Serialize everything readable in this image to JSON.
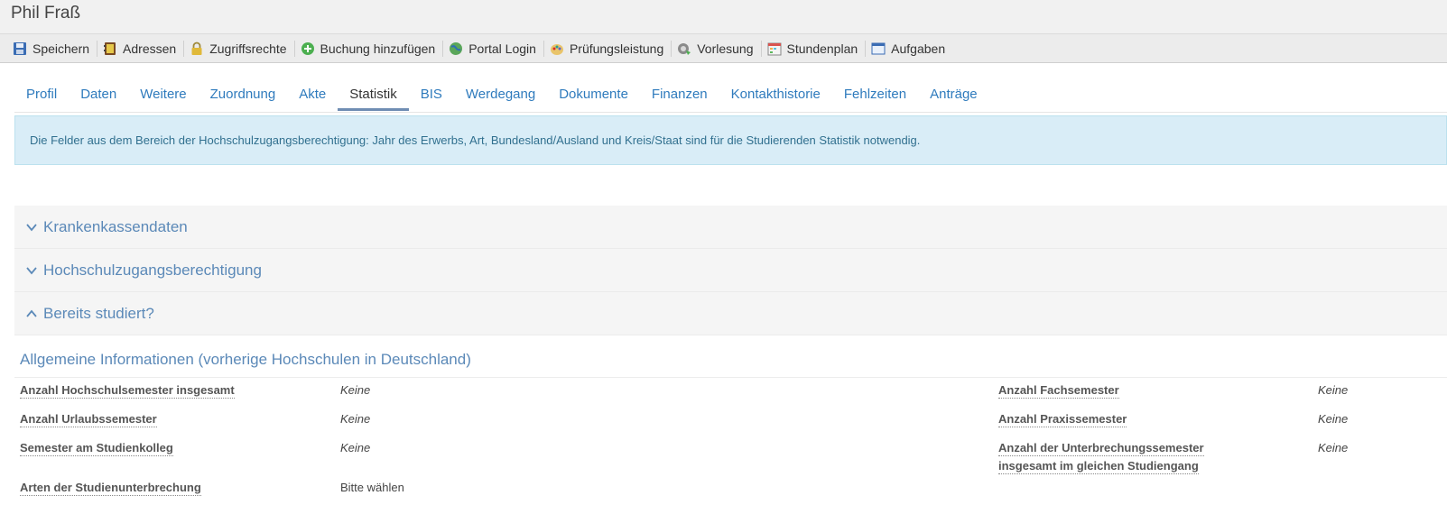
{
  "page_title": "Phil Fraß",
  "toolbar": [
    {
      "label": "Speichern",
      "icon": "save-icon"
    },
    {
      "label": "Adressen",
      "icon": "address-book-icon"
    },
    {
      "label": "Zugriffsrechte",
      "icon": "lock-icon"
    },
    {
      "label": "Buchung hinzufügen",
      "icon": "add-icon"
    },
    {
      "label": "Portal Login",
      "icon": "globe-icon"
    },
    {
      "label": "Prüfungsleistung",
      "icon": "palette-icon"
    },
    {
      "label": "Vorlesung",
      "icon": "lecture-icon"
    },
    {
      "label": "Stundenplan",
      "icon": "calendar-icon"
    },
    {
      "label": "Aufgaben",
      "icon": "window-icon"
    }
  ],
  "tabs": [
    "Profil",
    "Daten",
    "Weitere",
    "Zuordnung",
    "Akte",
    "Statistik",
    "BIS",
    "Werdegang",
    "Dokumente",
    "Finanzen",
    "Kontakthistorie",
    "Fehlzeiten",
    "Anträge"
  ],
  "active_tab": "Statistik",
  "info_text": "Die Felder aus dem Bereich der Hochschulzugangsberechtigung: Jahr des Erwerbs, Art, Bundesland/Ausland und Kreis/Staat sind für die Studierenden Statistik notwendig.",
  "panels": [
    {
      "label": "Krankenkassendaten",
      "state": "collapsed"
    },
    {
      "label": "Hochschulzugangsberechtigung",
      "state": "collapsed"
    },
    {
      "label": "Bereits studiert?",
      "state": "expanded"
    }
  ],
  "section_heading": "Allgemeine Informationen (vorherige Hochschulen in Deutschland)",
  "fields": {
    "hochschulsemester": {
      "label": "Anzahl Hochschulsemester insgesamt",
      "value": "Keine"
    },
    "urlaubssemester": {
      "label": "Anzahl Urlaubssemester",
      "value": "Keine"
    },
    "studienkolleg": {
      "label": "Semester am Studienkolleg",
      "value": "Keine"
    },
    "unterbrechung_arten": {
      "label": "Arten der Studienunterbrechung",
      "value": "Bitte wählen"
    },
    "fachsemester": {
      "label": "Anzahl Fachsemester",
      "value": "Keine"
    },
    "praxissemester": {
      "label": "Anzahl Praxissemester",
      "value": "Keine"
    },
    "unterbrechungssemester": {
      "label_line1": "Anzahl der Unterbrechungssemester",
      "label_line2": "insgesamt im gleichen Studiengang",
      "value": "Keine"
    }
  },
  "colors": {
    "accent": "#2f7bbd",
    "info_bg": "#d9edf7",
    "info_text": "#31708f",
    "panel_text": "#5b89b8",
    "active_tab_underline": "#6f8db3"
  }
}
